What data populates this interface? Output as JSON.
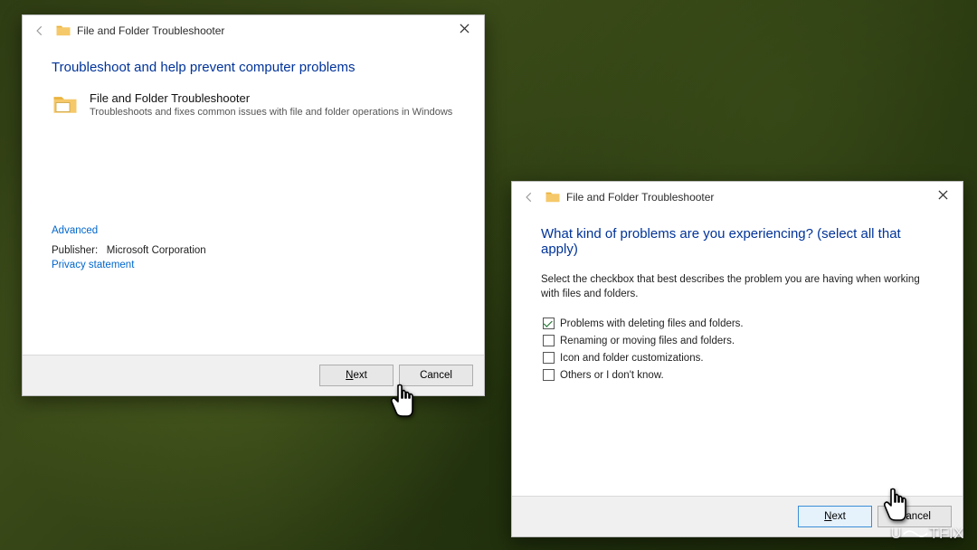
{
  "watermark": {
    "prefix": "U",
    "suffix": "TFIX"
  },
  "dialogA": {
    "title": "File and Folder Troubleshooter",
    "heading": "Troubleshoot and help prevent computer problems",
    "item_title": "File and Folder Troubleshooter",
    "item_desc": "Troubleshoots and fixes common issues with file and folder operations in Windows",
    "advanced": "Advanced",
    "publisher_label": "Publisher:",
    "publisher_value": "Microsoft Corporation",
    "privacy": "Privacy statement",
    "next_prefix": "N",
    "next_rest": "ext",
    "cancel": "Cancel"
  },
  "dialogB": {
    "title": "File and Folder Troubleshooter",
    "heading": "What kind of problems are you experiencing? (select all that apply)",
    "instruction": "Select the checkbox that best describes the problem you are having when working with files and folders.",
    "options": [
      {
        "label": "Problems with deleting files and folders.",
        "checked": true
      },
      {
        "label": "Renaming or moving files and folders.",
        "checked": false
      },
      {
        "label": "Icon and folder customizations.",
        "checked": false
      },
      {
        "label": "Others or I don't know.",
        "checked": false
      }
    ],
    "next_prefix": "N",
    "next_rest": "ext",
    "cancel": "Cancel"
  }
}
